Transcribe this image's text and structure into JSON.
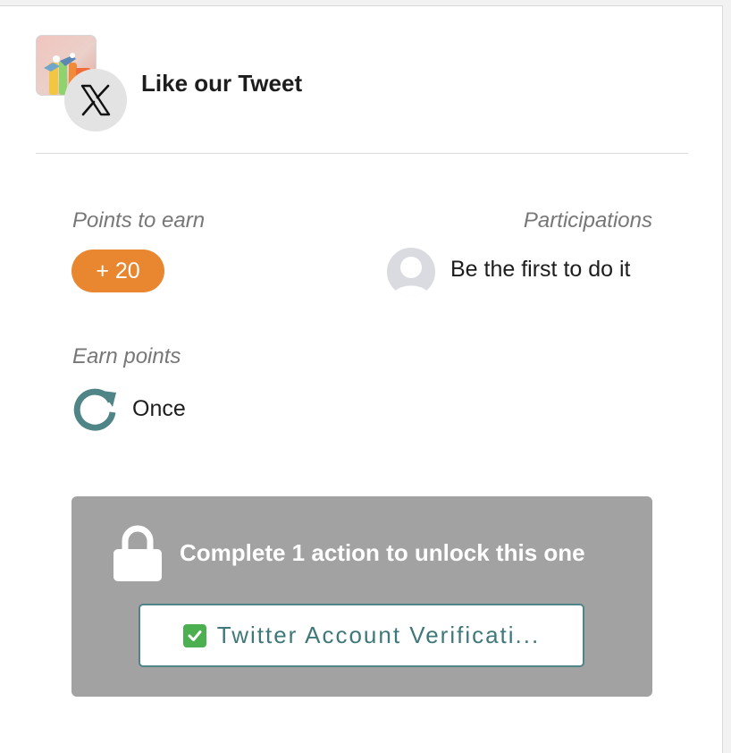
{
  "quest": {
    "title": "Like our Tweet"
  },
  "points": {
    "label": "Points to earn",
    "value": "+ 20"
  },
  "participations": {
    "label": "Participations",
    "text": "Be the first to do it"
  },
  "earn": {
    "label": "Earn points",
    "frequency": "Once"
  },
  "lock": {
    "message": "Complete 1 action to unlock this one",
    "required_action_label": "Twitter Account Verificati..."
  },
  "colors": {
    "points_badge": "#e8872f",
    "locked_panel": "#a2a2a2",
    "teal_accent": "#4f8586",
    "check": "#4caf50"
  },
  "icons": {
    "brand": "brand-thumbnail-icon",
    "social": "x-logo-icon",
    "participant": "user-avatar-icon",
    "frequency": "repeat-icon",
    "lock": "lock-icon",
    "check": "check-mark-icon"
  }
}
